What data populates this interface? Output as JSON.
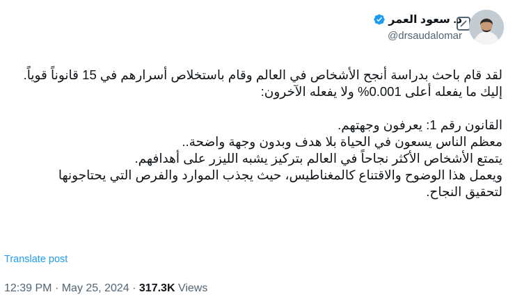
{
  "author": {
    "display_name": "د. سعود العمر",
    "handle": "@drsaudalomar",
    "verified": true,
    "verified_color": "#1d9bf0"
  },
  "tweet": {
    "text": "لقد قام باحث بدراسة أنجح الأشخاص في العالم وقام باستخلاص أسرارهم في 15 قانوناً قوياً.\nإليك ما يفعله أعلى 0.001% ولا يفعله الآخرون:\n\nالقانون رقم 1: يعرفون وجهتهم.\nمعظم الناس يسعون في الحياة بلا هدف وبدون وجهة واضحة..\nيتمتع الأشخاص الأكثر نجاحاً في العالم بتركيز يشبه الليزر على أهدافهم.\nويعمل هذا الوضوح والاقتناع كالمغناطيس، حيث يجذب الموارد والفرص التي يحتاجونها لتحقيق النجاح.",
    "translate_label": "Translate post"
  },
  "meta": {
    "time": "12:39 PM",
    "separator": "·",
    "date": "May 25, 2024",
    "views_count": "317.3K",
    "views_label": "Views"
  },
  "icons": {
    "grok": "grok-icon",
    "more": "more-options-icon",
    "verified": "verified-badge-icon"
  }
}
